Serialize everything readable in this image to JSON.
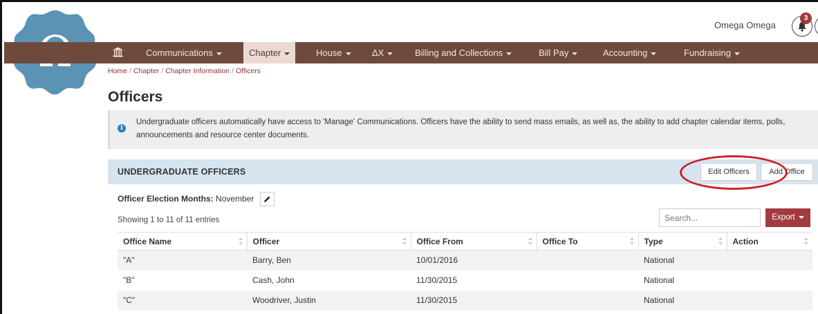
{
  "user": {
    "name": "Omega Omega",
    "notification_count": "3"
  },
  "logo": {
    "glyph": "Ω",
    "color": "#5b93b5"
  },
  "nav": {
    "bg_color": "#6e4a3d",
    "items": [
      {
        "label": "Communications",
        "caret": true
      },
      {
        "label": "Chapter",
        "caret": true,
        "active": true
      },
      {
        "label": "House",
        "caret": true
      },
      {
        "label": "ΔX",
        "caret": true
      },
      {
        "label": "Billing and Collections",
        "caret": true
      },
      {
        "label": "Bill Pay",
        "caret": true
      },
      {
        "label": "Accounting",
        "caret": true
      },
      {
        "label": "Fundraising",
        "caret": true
      }
    ]
  },
  "breadcrumb": {
    "items": [
      "Home",
      "Chapter",
      "Chapter Information"
    ],
    "current": "Officers"
  },
  "page": {
    "title": "Officers"
  },
  "alert": {
    "text": "Undergraduate officers automatically have access to 'Manage' Communications. Officers have the ability to send mass emails, as well as, the ability to add chapter calendar items, polls, announcements and resource center documents."
  },
  "section": {
    "title": "UNDERGRADUATE OFFICERS",
    "edit_button": "Edit Officers",
    "add_button": "Add Office"
  },
  "election": {
    "label": "Officer Election Months:",
    "value": "November"
  },
  "listing": {
    "showing": "Showing 1 to 11 of 11 entries",
    "search_placeholder": "Search...",
    "export_label": "Export"
  },
  "table": {
    "columns": [
      "Office Name",
      "Officer",
      "Office From",
      "Office To",
      "Type",
      "Action"
    ],
    "rows": [
      [
        "\"A\"",
        "Barry, Ben",
        "10/01/2016",
        "",
        "National",
        ""
      ],
      [
        "\"B\"",
        "Cash, John",
        "11/30/2015",
        "",
        "National",
        ""
      ],
      [
        "\"C\"",
        "Woodriver, Justin",
        "11/30/2015",
        "",
        "National",
        ""
      ]
    ]
  },
  "colors": {
    "accent": "#a23a3f",
    "section_bg": "#d6e4ef",
    "highlight": "#cc2027"
  }
}
